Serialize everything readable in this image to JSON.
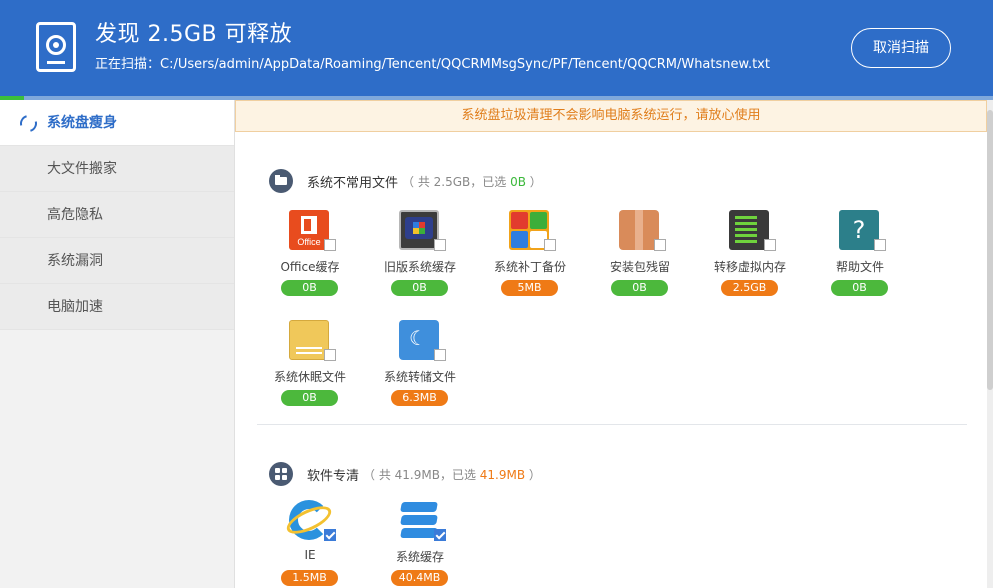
{
  "header": {
    "title": "发现 2.5GB 可释放",
    "scanning_text": "正在扫描：C:/Users/admin/AppData/Roaming/Tencent/QQCRMMsgSync/PF/Tencent/QQCRM/Whatsnew.txt",
    "cancel_label": "取消扫描"
  },
  "progress": {
    "fraction": 0.024
  },
  "sidebar": {
    "items": [
      {
        "label": "系统盘瘦身",
        "active": true
      },
      {
        "label": "大文件搬家"
      },
      {
        "label": "高危隐私"
      },
      {
        "label": "系统漏洞"
      },
      {
        "label": "电脑加速"
      }
    ]
  },
  "notice": "系统盘垃圾清理不会影响电脑系统运行，请放心使用",
  "sections": [
    {
      "title": "系统不常用文件",
      "summary_prefix": "（ 共 2.5GB，已选 ",
      "summary_selected": "0B",
      "summary_suffix": " ）",
      "items": [
        {
          "label": "Office缓存",
          "size": "0B",
          "color": "green",
          "checked": false
        },
        {
          "label": "旧版系统缓存",
          "size": "0B",
          "color": "green",
          "checked": false
        },
        {
          "label": "系统补丁备份",
          "size": "5MB",
          "color": "orange",
          "checked": false
        },
        {
          "label": "安装包残留",
          "size": "0B",
          "color": "green",
          "checked": false
        },
        {
          "label": "转移虚拟内存",
          "size": "2.5GB",
          "color": "orange",
          "checked": false
        },
        {
          "label": "帮助文件",
          "size": "0B",
          "color": "green",
          "checked": false
        },
        {
          "label": "系统休眠文件",
          "size": "0B",
          "color": "green",
          "checked": false
        },
        {
          "label": "系统转储文件",
          "size": "6.3MB",
          "color": "orange",
          "checked": false
        }
      ]
    },
    {
      "title": "软件专清",
      "summary_prefix": "（ 共 41.9MB，已选 ",
      "summary_selected": "41.9MB",
      "summary_suffix": " ）",
      "items": [
        {
          "label": "IE",
          "size": "1.5MB",
          "color": "orange",
          "checked": true
        },
        {
          "label": "系统缓存",
          "size": "40.4MB",
          "color": "orange",
          "checked": true
        }
      ]
    }
  ],
  "icons": {
    "office_text": "Office",
    "help_glyph": "?"
  }
}
